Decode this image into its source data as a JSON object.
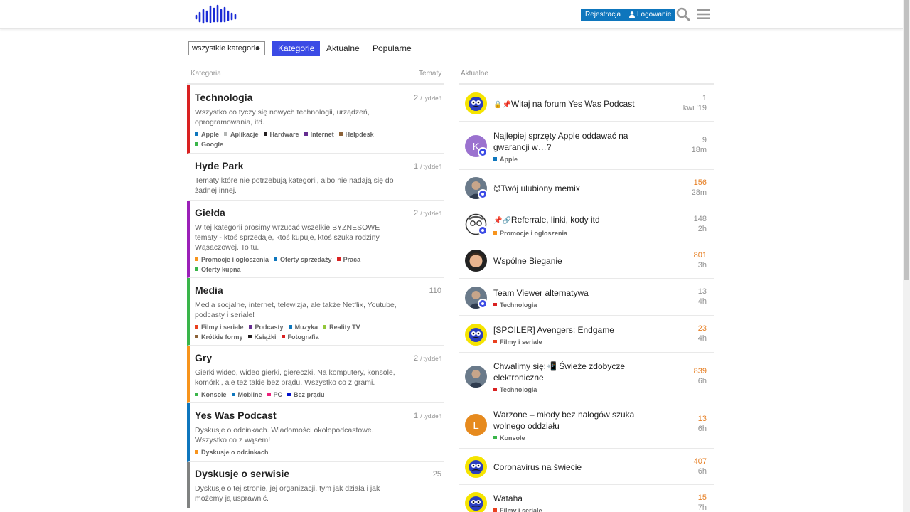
{
  "header": {
    "logo": "waveform-logo",
    "register_label": "Rejestracja",
    "login_label": "Logowanie",
    "accent": "#0e76bd"
  },
  "nav": {
    "dropdown_label": "wszystkie kategorie",
    "tabs": [
      "Kategorie",
      "Aktualne",
      "Popularne"
    ],
    "active_tab": "Kategorie",
    "active_color": "#3b4be5"
  },
  "categories_column": {
    "heading": "Kategoria",
    "topics_heading": "Tematy",
    "items": [
      {
        "title": "Technologia",
        "desc": "Wszystko co tyczy się nowych technologii, urządzeń, oprogramowania, itd.",
        "count": "2",
        "per": "/ tydzień",
        "color": "#d92121",
        "subs": [
          {
            "name": "Apple",
            "color": "#0e76bd"
          },
          {
            "name": "Aplikacje",
            "color": "#b3b5b4"
          },
          {
            "name": "Hardware",
            "color": "#231f20"
          },
          {
            "name": "Internet",
            "color": "#652d90"
          },
          {
            "name": "Helpdesk",
            "color": "#8c6238"
          },
          {
            "name": "Google",
            "color": "#3ab54a"
          }
        ]
      },
      {
        "title": "Hyde Park",
        "desc": "Tematy które nie potrzebują kategorii, albo nie nadają się do żadnej innej.",
        "count": "1",
        "per": "/ tydzień",
        "color": "#ffffff",
        "subs": []
      },
      {
        "title": "Giełda",
        "desc": "W tej kategorii prosimy wrzucać wszelkie BYZNESOWE tematy - ktoś sprzedaje, ktoś kupuje, ktoś szuka rodziny Wąsaczowej. To tu.",
        "count": "2",
        "per": "/ tydzień",
        "color": "#9b20b8",
        "subs": [
          {
            "name": "Promocje i ogłoszenia",
            "color": "#f7941d"
          },
          {
            "name": "Oferty sprzedaży",
            "color": "#0e76bd"
          },
          {
            "name": "Praca",
            "color": "#d92121"
          },
          {
            "name": "Oferty kupna",
            "color": "#3ab54a"
          }
        ]
      },
      {
        "title": "Media",
        "desc": "Media socjalne, internet, telewizja, ale także Netflix, Youtube, podcasty i seriale!",
        "count": "110",
        "per": "",
        "color": "#3ab54a",
        "subs": [
          {
            "name": "Filmy i seriale",
            "color": "#e9401f"
          },
          {
            "name": "Podcasty",
            "color": "#652d90"
          },
          {
            "name": "Muzyka",
            "color": "#0e76bd"
          },
          {
            "name": "Reality TV",
            "color": "#92c63a"
          },
          {
            "name": "Krótkie formy",
            "color": "#8c6238"
          },
          {
            "name": "Książki",
            "color": "#231f20"
          },
          {
            "name": "Fotografia",
            "color": "#d92121"
          }
        ]
      },
      {
        "title": "Gry",
        "desc": "Gierki wideo, wideo gierki, giereczki. Na komputery, konsole, komórki, ale też takie bez prądu. Wszystko co z grami.",
        "count": "2",
        "per": "/ tydzień",
        "color": "#f7941d",
        "subs": [
          {
            "name": "Konsole",
            "color": "#3ab54a"
          },
          {
            "name": "Mobilne",
            "color": "#0e76bd"
          },
          {
            "name": "PC",
            "color": "#ed207b"
          },
          {
            "name": "Bez prądu",
            "color": "#0011cc"
          }
        ]
      },
      {
        "title": "Yes Was Podcast",
        "desc": "Dyskusje o odcinkach. Wiadomości okołopodcastowe. Wszystko co z wąsem!",
        "count": "1",
        "per": "/ tydzień",
        "color": "#0e76bd",
        "subs": [
          {
            "name": "Dyskusje o odcinkach",
            "color": "#f7941d"
          }
        ]
      },
      {
        "title": "Dyskusje o serwisie",
        "desc": "Dyskusje o tej stronie, jej organizacji, tym jak działa i jak możemy ją usprawnić.",
        "count": "25",
        "per": "",
        "color": "#808281",
        "subs": []
      }
    ]
  },
  "latest_column": {
    "heading": "Aktualne",
    "topics": [
      {
        "title": "Witaj na forum Yes Was Podcast",
        "prefix": "🔒📌",
        "category": "",
        "cat_color": "",
        "replies": "1",
        "age": "kwi '19",
        "hot": false,
        "avatar": "mustache-avatar"
      },
      {
        "title": "Najlepiej sprzęty Apple oddawać na gwarancji w…?",
        "prefix": "",
        "category": "Apple",
        "cat_color": "#0e76bd",
        "replies": "9",
        "age": "18m",
        "hot": false,
        "avatar": "letter-k-avatar"
      },
      {
        "title": "Twój ulubiony memix",
        "prefix": "😈",
        "category": "",
        "cat_color": "",
        "replies": "156",
        "age": "28m",
        "hot": true,
        "avatar": "photo-avatar"
      },
      {
        "title": "Referrale, linki, kody itd",
        "prefix": "📌🔗",
        "category": "Promocje i ogłoszenia",
        "cat_color": "#f7941d",
        "replies": "148",
        "age": "2h",
        "hot": false,
        "avatar": "glasses-avatar"
      },
      {
        "title": "Wspólne Bieganie",
        "prefix": "",
        "category": "",
        "cat_color": "",
        "replies": "801",
        "age": "3h",
        "hot": true,
        "avatar": "memoji-avatar"
      },
      {
        "title": "Team Viewer alternatywa",
        "prefix": "",
        "category": "Technologia",
        "cat_color": "#d92121",
        "replies": "13",
        "age": "4h",
        "hot": false,
        "avatar": "photo-avatar"
      },
      {
        "title": "[SPOILER] Avengers: Endgame",
        "prefix": "",
        "category": "Filmy i seriale",
        "cat_color": "#e9401f",
        "replies": "23",
        "age": "4h",
        "hot": true,
        "avatar": "mustache-avatar"
      },
      {
        "title": "Chwalimy się:📲 Świeże zdobycze elektroniczne",
        "prefix": "",
        "category": "Technologia",
        "cat_color": "#d92121",
        "replies": "839",
        "age": "6h",
        "hot": true,
        "avatar": "photo-avatar"
      },
      {
        "title": "Warzone – młody bez nałogów szuka wolnego oddziału",
        "prefix": "",
        "category": "Konsole",
        "cat_color": "#3ab54a",
        "replies": "13",
        "age": "6h",
        "hot": true,
        "avatar": "letter-l-avatar"
      },
      {
        "title": "Coronavirus na świecie",
        "prefix": "",
        "category": "",
        "cat_color": "",
        "replies": "407",
        "age": "6h",
        "hot": true,
        "avatar": "mustache-avatar"
      },
      {
        "title": "Wataha",
        "prefix": "",
        "category": "Filmy i seriale",
        "cat_color": "#e9401f",
        "replies": "15",
        "age": "7h",
        "hot": true,
        "avatar": "mustache-avatar"
      }
    ]
  }
}
